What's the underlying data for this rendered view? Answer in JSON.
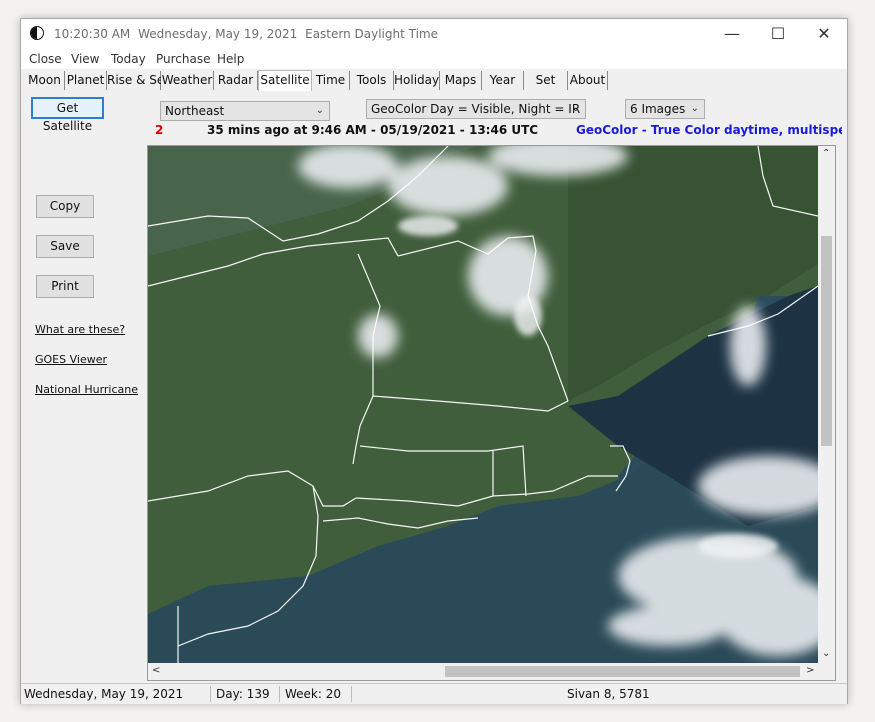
{
  "titlebar": {
    "time": "10:20:30  AM",
    "date": "Wednesday, May 19, 2021",
    "timezone": "Eastern Daylight Time"
  },
  "window_controls": {
    "minimize": "—",
    "maximize": "☐",
    "close": "✕"
  },
  "menu": [
    "Close",
    "View",
    "Today",
    "Purchase",
    "Help"
  ],
  "tabs": [
    {
      "label": "Moon"
    },
    {
      "label": "Planet"
    },
    {
      "label": "Rise & Set"
    },
    {
      "label": "Weather"
    },
    {
      "label": "Radar"
    },
    {
      "label": "Satellite",
      "active": true
    },
    {
      "label": "Time"
    },
    {
      "label": "Tools"
    },
    {
      "label": "Holiday"
    },
    {
      "label": "Maps"
    },
    {
      "label": "Year"
    },
    {
      "label": "Set"
    },
    {
      "label": "About"
    }
  ],
  "sidebar": {
    "get_satellite": "Get Satellite",
    "copy": "Copy",
    "save": "Save",
    "print": "Print",
    "links": [
      "What are these?",
      "GOES Viewer",
      "National Hurricane"
    ]
  },
  "controls": {
    "region": "Northeast",
    "product": "GeoColor Day = Visible, Night = IR",
    "count": "6 Images"
  },
  "info": {
    "index": "2",
    "age": "35  mins ago at 9:46 AM  -  05/19/2021  -  13:46 UTC",
    "description": "GeoColor - True Color daytime, multispectral IR a"
  },
  "colors": {
    "index": "#dd0000",
    "description": "#1a1adc",
    "focus": "#2a7fd4"
  },
  "statusbar": {
    "date": "Wednesday, May 19, 2021",
    "day": "Day: 139",
    "week": "Week: 20",
    "hebrew": "Sivan 8, 5781"
  }
}
